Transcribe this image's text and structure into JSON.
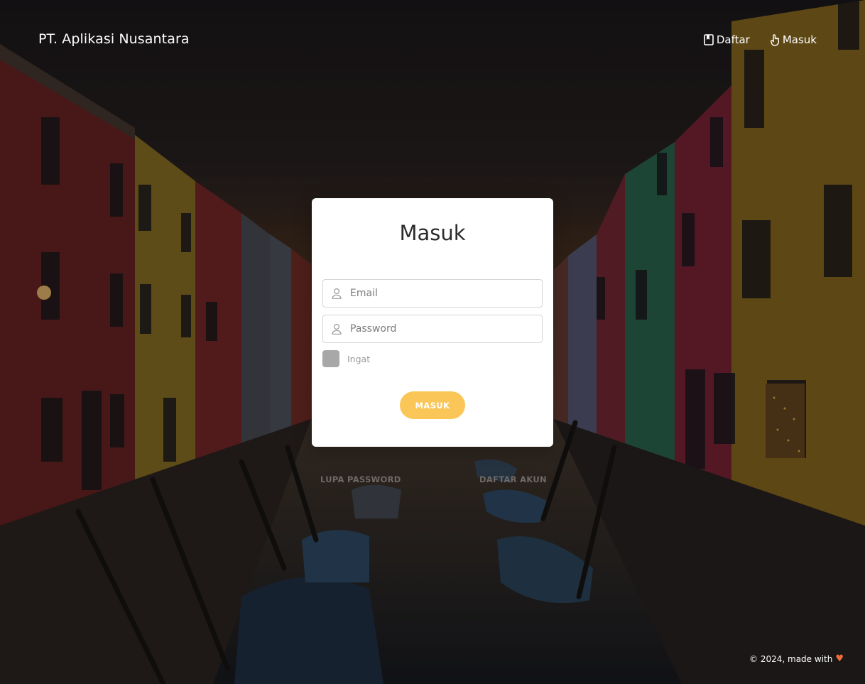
{
  "header": {
    "brand": "PT. Aplikasi Nusantara",
    "nav": [
      {
        "label": "Daftar",
        "icon": "book-icon"
      },
      {
        "label": "Masuk",
        "icon": "hand-pointer-icon"
      }
    ]
  },
  "login_card": {
    "title": "Masuk",
    "email_placeholder": "Email",
    "password_placeholder": "Password",
    "remember_label": "Ingat",
    "submit_label": "MASUK"
  },
  "links": {
    "forgot_password": "LUPA PASSWORD",
    "register_account": "DAFTAR AKUN"
  },
  "footer": {
    "text": "© 2024, made with",
    "heart": "♥"
  },
  "colors": {
    "accent": "#fbc658",
    "checkbox": "#a8a8a8",
    "heart": "#ef6b3c"
  }
}
